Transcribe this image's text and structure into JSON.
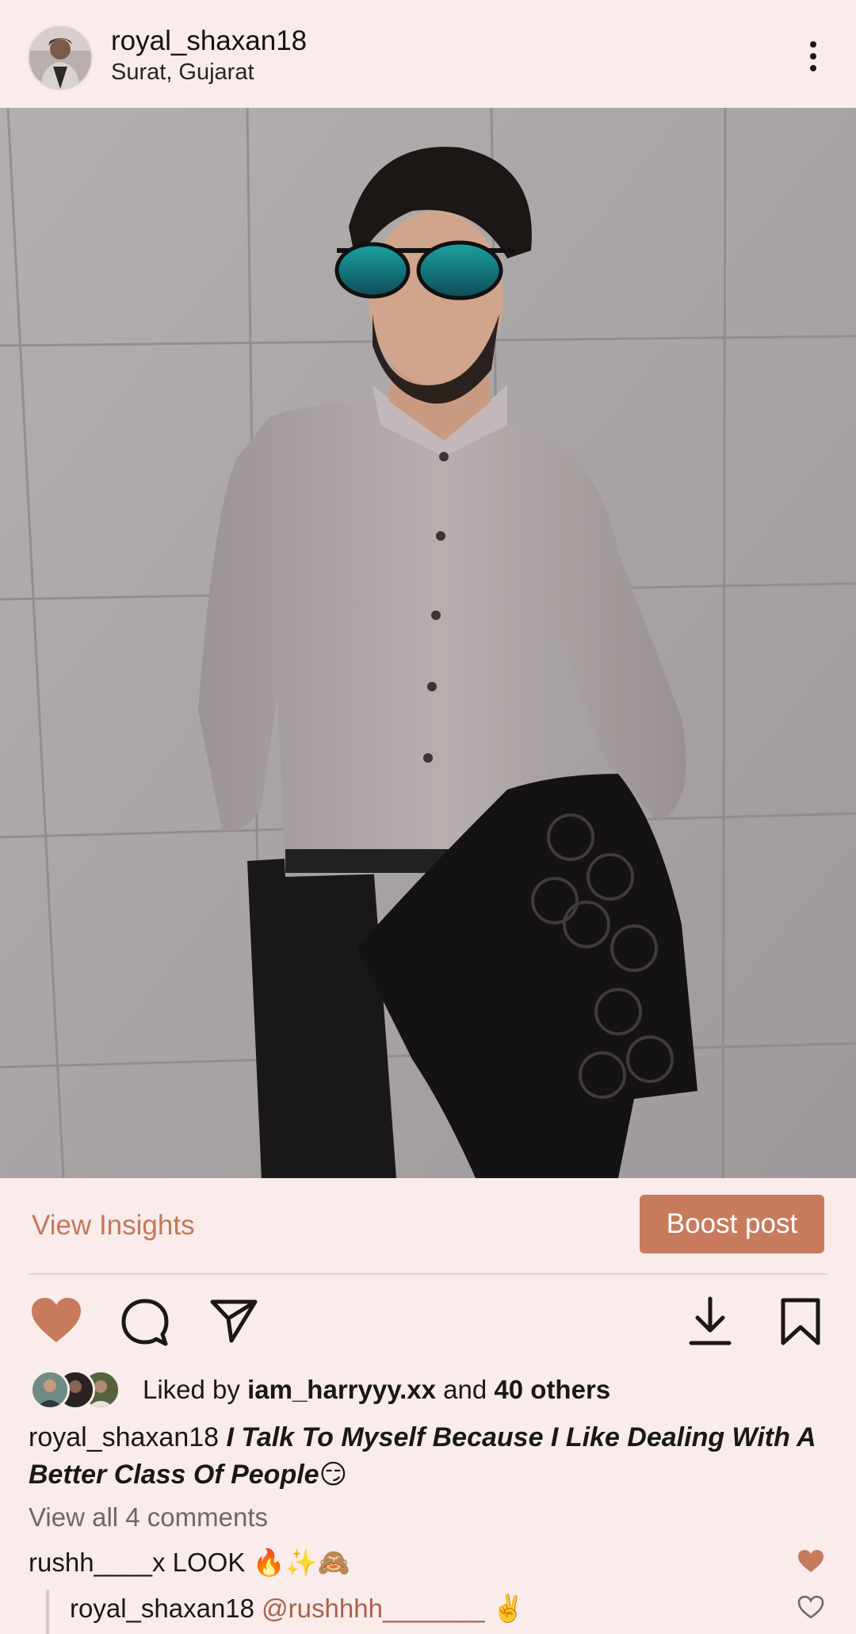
{
  "post": {
    "username": "royal_shaxan18",
    "location": "Surat, Gujarat",
    "image_icon": "person-in-grey-shirt-photo"
  },
  "insights": {
    "view_insights_label": "View Insights",
    "boost_label": "Boost post"
  },
  "actions": {
    "like_icon": "heart-filled-icon",
    "comment_icon": "comment-icon",
    "share_icon": "send-icon",
    "download_icon": "download-icon",
    "save_icon": "bookmark-icon",
    "like_color": "#c87b5c"
  },
  "likes": {
    "prefix": "Liked by ",
    "user": "iam_harryyy.xx",
    "middle": " and ",
    "others": "40 others"
  },
  "caption": {
    "username": "royal_shaxan18",
    "text": "I Talk To Myself Because I Like Dealing With A Better Class Of People😏"
  },
  "comments": {
    "view_all": "View all 4 comments",
    "items": [
      {
        "user": "rushh____x",
        "text": "LOOK 🔥✨🙈",
        "liked": true
      },
      {
        "user": "royal_shaxan18",
        "mention": "@rushhhh_______",
        "text": "✌️",
        "liked": false
      }
    ]
  }
}
